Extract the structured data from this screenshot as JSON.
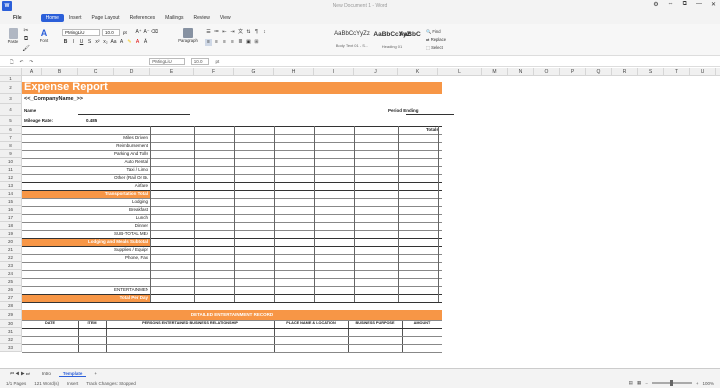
{
  "window": {
    "title": "New Document 1 - Word",
    "controls": [
      "⚙",
      "⇔",
      "⧉",
      "—",
      "✕"
    ]
  },
  "menu": {
    "file": "File",
    "items": [
      "Home",
      "Insert",
      "Page Layout",
      "References",
      "Mailings",
      "Review",
      "View"
    ],
    "active": "Home"
  },
  "ribbon": {
    "paste": "Paste",
    "font_label": "Font",
    "paragraph": "Paragraph",
    "font_name": "PMingLiU",
    "font_size": "10.0",
    "font_unit": "pt",
    "styles": [
      {
        "sample": "AaBbCcYyZz",
        "name": "Body Text 01 - S..."
      },
      {
        "sample": "AaBbCcYyZ",
        "name": "Heading 01"
      },
      {
        "sample": "AaBbCcYyZ",
        "name": "Heading 02"
      }
    ],
    "find": "Find",
    "replace": "Replace",
    "select": "Select"
  },
  "formula": {
    "font_name": "PMingLiU",
    "font_size": "10.0",
    "unit": "pt"
  },
  "columns": [
    "A",
    "B",
    "C",
    "D",
    "E",
    "F",
    "G",
    "H",
    "I",
    "J",
    "K",
    "L",
    "M",
    "N",
    "O",
    "P",
    "Q",
    "R",
    "S",
    "T",
    "U",
    "V"
  ],
  "rows": [
    "1",
    "2",
    "3",
    "4",
    "5",
    "6",
    "7",
    "8",
    "9",
    "10",
    "11",
    "12",
    "13",
    "14",
    "15",
    "16",
    "17",
    "18",
    "19",
    "20",
    "21",
    "22",
    "23",
    "24",
    "25",
    "26",
    "27",
    "28",
    "29",
    "30",
    "31",
    "32",
    "33"
  ],
  "report": {
    "title": "Expense Report",
    "company": "<<_CompanyName_>>",
    "name_label": "Name",
    "period_label": "Period Ending",
    "mileage_label": "Mileage Rate:",
    "mileage_value": "0.485",
    "totals_label": "Totals",
    "transport_items": [
      "Miles Driven",
      "Reimbursement",
      "Parking And Tolls",
      "Auto Rental",
      "Taxi / Limo",
      "Other (Rail Or Bus)",
      "Airfare"
    ],
    "transport_total": "Transportation Total",
    "lodging_items": [
      "Lodging",
      "Breakfast",
      "Lunch",
      "Dinner",
      "SUB-TOTAL MEALS"
    ],
    "lodging_total": "Lodging and Meals Subtotal",
    "other_items": [
      "Supplies / Equipment",
      "Phone, Fax"
    ],
    "entertainment": "ENTERTAINMENT",
    "total_per_day": "Total Per Day",
    "detail_header": "DETAILED ENTERTAINMENT RECORD",
    "detail_cols": [
      "DATE",
      "ITEM",
      "PERSONS ENTERTAINED BUSINESS RELATIONSHIP",
      "PLACE NAME & LOCATION",
      "BUSINESS PURPOSE",
      "AMOUNT"
    ]
  },
  "sheets": {
    "tabs": [
      "Intro",
      "Template"
    ],
    "active": "Template",
    "add": "+"
  },
  "status": {
    "pages": "1/1 Pages",
    "words": "121 Word(s)",
    "mode": "Insert",
    "tracking": "Track Changes: Stopped",
    "zoom": "100%"
  },
  "colors": {
    "accent": "#2b5fd9",
    "orange": "#f79646"
  }
}
